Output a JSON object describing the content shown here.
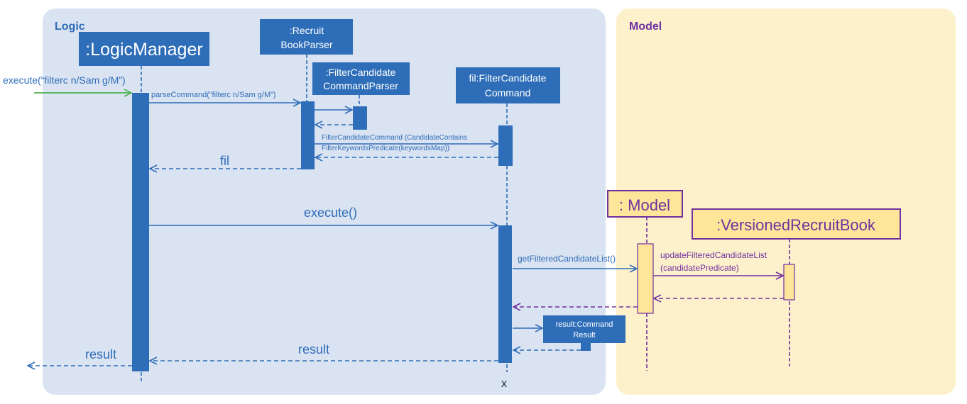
{
  "colors": {
    "logic_bg": "#dae3f2",
    "model_bg": "#fdf1cc",
    "logic_blue": "#2e6db8",
    "model_purple": "#7030a0",
    "model_box": "#fde699",
    "incoming_arrow": "#4caf50"
  },
  "frames": {
    "logic": "Logic",
    "model": "Model"
  },
  "participants": {
    "logic_manager": ":LogicManager",
    "recruit_book_parser": [
      ":Recruit",
      "BookParser"
    ],
    "filter_candidate_command_parser": [
      ":FilterCandidate",
      "CommandParser"
    ],
    "filter_candidate_command": [
      "fil:FilterCandidate",
      "Command"
    ],
    "model": ": Model",
    "versioned_recruit_book": ":VersionedRecruitBook",
    "command_result": [
      "result:Command",
      "Result"
    ]
  },
  "messages": {
    "execute_input": "execute(“filterc n/Sam g/M”)",
    "parse_command": "parseCommand(“filterc n/Sam g/M”)",
    "create_command": [
      "FilterCandidateCommand (CandidateContains",
      "FilterKeywordsPredicate(keywordsMap))"
    ],
    "return_fil": "fil",
    "execute": "execute()",
    "get_filtered": "getFilteredCandidateList()",
    "update_filtered": [
      "updateFilteredCandidateList",
      "(candidatePredicate)"
    ],
    "return_result": "result",
    "return_result_out": "result",
    "destroy_marker": "x"
  }
}
